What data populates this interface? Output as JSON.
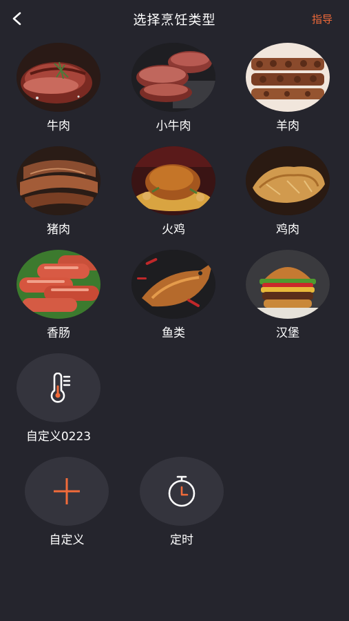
{
  "header": {
    "title": "选择烹饪类型",
    "guide_label": "指导"
  },
  "categories": [
    {
      "label": "牛肉",
      "icon": "beef-steak-image"
    },
    {
      "label": "小牛肉",
      "icon": "veal-image"
    },
    {
      "label": "羊肉",
      "icon": "lamb-skewers-image"
    },
    {
      "label": "猪肉",
      "icon": "pork-ribs-image"
    },
    {
      "label": "火鸡",
      "icon": "roast-turkey-image"
    },
    {
      "label": "鸡肉",
      "icon": "roast-chicken-image"
    },
    {
      "label": "香肠",
      "icon": "sausage-image"
    },
    {
      "label": "鱼类",
      "icon": "grilled-fish-image"
    },
    {
      "label": "汉堡",
      "icon": "burger-image"
    }
  ],
  "custom_presets": [
    {
      "label": "自定义0223",
      "icon": "thermometer-icon"
    }
  ],
  "actions": {
    "add_label": "自定义",
    "timer_label": "定时"
  },
  "colors": {
    "background": "#25252d",
    "accent": "#f26b3a",
    "circle": "#34343d"
  }
}
